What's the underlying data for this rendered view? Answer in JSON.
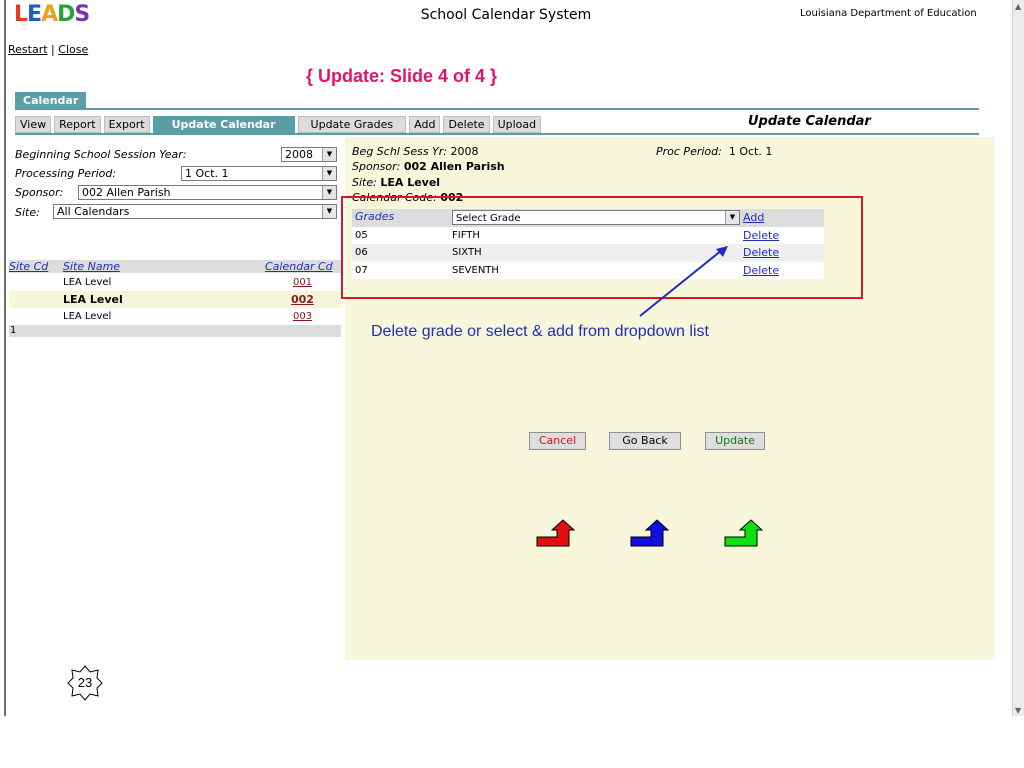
{
  "header": {
    "logo_text": "LEADS",
    "app_title": "School Calendar System",
    "department": "Louisiana Department of Education",
    "links": {
      "restart": "Restart",
      "separator": "|",
      "close": "Close"
    },
    "slide_title": "{ Update:  Slide 4 of 4 }"
  },
  "nav": {
    "section_tab": "Calendar",
    "toolbar": [
      "View",
      "Report",
      "Export",
      "Update Calendar",
      "Update Grades",
      "Add",
      "Delete",
      "Upload"
    ],
    "active": "Update Calendar",
    "page_heading": "Update Calendar"
  },
  "filters": {
    "year_label": "Beginning School Session Year:",
    "year_value": "2008",
    "period_label": "Processing Period:",
    "period_value": "1 Oct. 1",
    "sponsor_label": "Sponsor:",
    "sponsor_value": "002 Allen Parish",
    "site_label": "Site:",
    "site_value": "All Calendars"
  },
  "site_list": {
    "headers": [
      "Site Cd",
      "Site Name",
      "Calendar Cd"
    ],
    "rows": [
      {
        "site_cd": "",
        "site_name": "LEA Level",
        "calendar_cd": "001"
      },
      {
        "site_cd": "",
        "site_name": "LEA Level",
        "calendar_cd": "002",
        "selected": true
      },
      {
        "site_cd": "",
        "site_name": "LEA Level",
        "calendar_cd": "003"
      }
    ],
    "footer": "1"
  },
  "details": {
    "beg_label": "Beg Schl Sess Yr:",
    "beg_value": "2008",
    "proc_label": "Proc Period:",
    "proc_value": "1 Oct. 1",
    "sponsor_label": "Sponsor:",
    "sponsor_value": "002 Allen Parish",
    "site_label": "Site:",
    "site_value": "LEA Level",
    "calendar_label": "Calendar Code:",
    "calendar_value": "002"
  },
  "grades": {
    "header": "Grades",
    "select_placeholder": "Select Grade",
    "add_label": "Add",
    "delete_label": "Delete",
    "rows": [
      {
        "code": "05",
        "name": "FIFTH"
      },
      {
        "code": "06",
        "name": "SIXTH"
      },
      {
        "code": "07",
        "name": "SEVENTH"
      }
    ]
  },
  "annotation": "Delete grade or select & add from dropdown list",
  "actions": {
    "cancel": "Cancel",
    "go_back": "Go Back",
    "update": "Update"
  },
  "colors": {
    "cancel_arrow": "#e01010",
    "goback_arrow": "#1010e0",
    "update_arrow": "#10e010",
    "teal": "#5b9ea5",
    "callout": "#d41a1a"
  },
  "slide_number": "23"
}
